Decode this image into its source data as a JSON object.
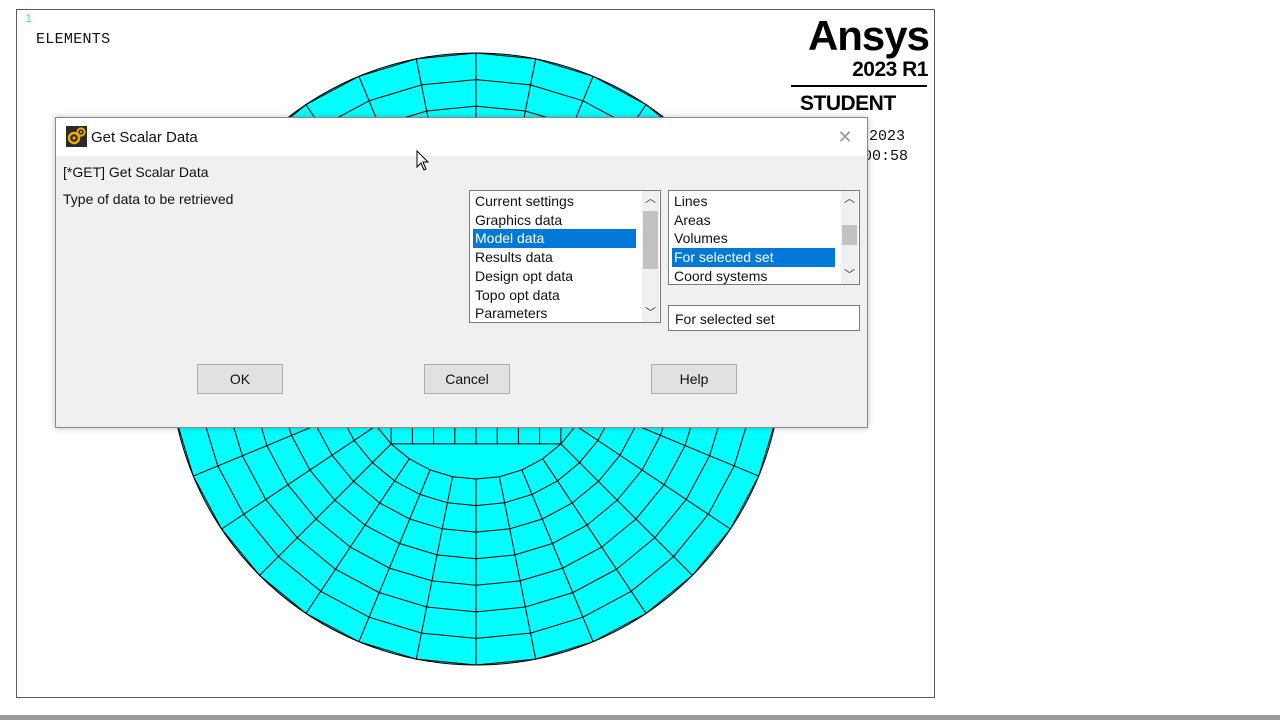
{
  "graphics": {
    "window_number": "1",
    "label": "ELEMENTS",
    "date_fragment": "2023",
    "time_fragment": "00:58",
    "mesh_color": "#00ffff",
    "logo": {
      "brand": "Ansys",
      "version": "2023 R1",
      "edition": "STUDENT"
    }
  },
  "dialog": {
    "title": "Get Scalar Data",
    "close_icon": "close-icon",
    "command_label": "[*GET]  Get Scalar Data",
    "type_label": "Type of data to be retrieved",
    "category_list": {
      "items": [
        "Current settings",
        "Graphics data",
        "Model data",
        "Results data",
        "Design opt data",
        "Topo opt data",
        "Parameters"
      ],
      "selected": "Model data"
    },
    "item_list": {
      "items": [
        "Lines",
        "Areas",
        "Volumes",
        "For selected set",
        "Coord systems"
      ],
      "selected": "For selected set"
    },
    "selection_value": "For selected set",
    "buttons": {
      "ok": "OK",
      "cancel": "Cancel",
      "help": "Help"
    }
  }
}
